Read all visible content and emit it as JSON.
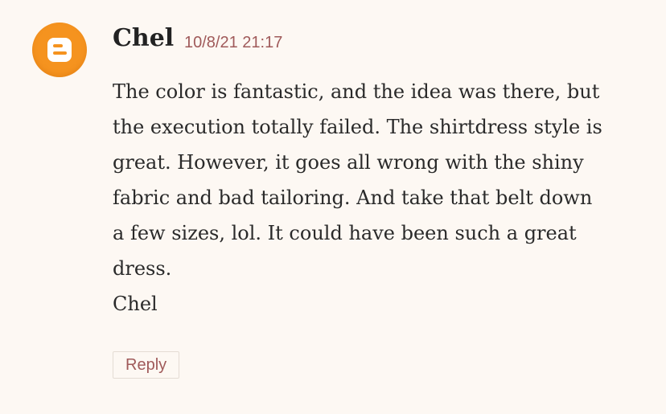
{
  "comment": {
    "author": "Chel",
    "timestamp": "10/8/21 21:17",
    "avatar_icon": "blogger-icon",
    "avatar_color": "#f5931f",
    "body_lines": [
      "The color is fantastic, and the idea was there, but",
      "the execution totally failed. The shirtdress style is",
      "great. However, it goes all wrong with the shiny",
      "fabric and bad tailoring. And take that belt down",
      "a few sizes, lol. It could have been such a great",
      "dress.",
      "Chel"
    ],
    "reply_label": "Reply"
  },
  "colors": {
    "background": "#fdf8f3",
    "accent": "#a05a5a",
    "text": "#2a2a2a"
  }
}
